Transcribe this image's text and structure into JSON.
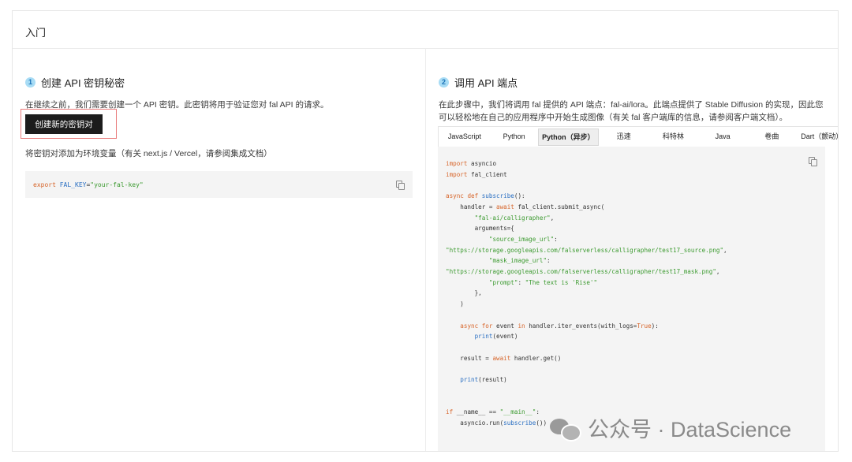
{
  "card": {
    "title": "入门"
  },
  "step1": {
    "number": "1",
    "title": "创建 API 密钥秘密",
    "description": "在继续之前，我们需要创建一个 API 密钥。此密钥将用于验证您对 fal API 的请求。",
    "button_label": "创建新的密钥对",
    "env_hint": "将密钥对添加为环境变量（有关 next.js / Vercel，请参阅集成文档）",
    "env_code": {
      "keyword": "export",
      "name": "FAL_KEY",
      "eq": "=",
      "value": "\"your-fal-key\""
    }
  },
  "step2": {
    "number": "2",
    "title": "调用 API 端点",
    "description_line1": "在此步骤中，我们将调用 fal 提供的 API 端点：fal-ai/lora。此端点提供了 Stable Diffusion 的实现，因此您",
    "description_line2": "可以轻松地在自己的应用程序中开始生成图像（有关 fal 客户端库的信息，请参阅客户端文档）。",
    "tabs": [
      {
        "label": "JavaScript",
        "active": false
      },
      {
        "label": "Python",
        "active": false
      },
      {
        "label": "Python（异步）",
        "active": true
      },
      {
        "label": "迅速",
        "active": false
      },
      {
        "label": "科特林",
        "active": false
      },
      {
        "label": "Java",
        "active": false
      },
      {
        "label": "卷曲",
        "active": false
      },
      {
        "label": "Dart（颤动）",
        "active": false
      }
    ],
    "code": [
      "import asyncio",
      "import fal_client",
      "",
      "async def subscribe():",
      "    handler = await fal_client.submit_async(",
      "        \"fal-ai/calligrapher\",",
      "        arguments={",
      "            \"source_image_url\":",
      "\"https://storage.googleapis.com/falserverless/calligrapher/test17_source.png\",",
      "            \"mask_image_url\":",
      "\"https://storage.googleapis.com/falserverless/calligrapher/test17_mask.png\",",
      "            \"prompt\": \"The text is 'Rise'\"",
      "        },",
      "    )",
      "",
      "    async for event in handler.iter_events(with_logs=True):",
      "        print(event)",
      "",
      "    result = await handler.get()",
      "",
      "    print(result)",
      "",
      "",
      "if __name__ == \"__main__\":",
      "    asyncio.run(subscribe())"
    ]
  },
  "watermark": {
    "text": "公众号 · DataScience"
  },
  "icons": {
    "copy": "copy-icon",
    "watermark": "wechat-icon"
  }
}
